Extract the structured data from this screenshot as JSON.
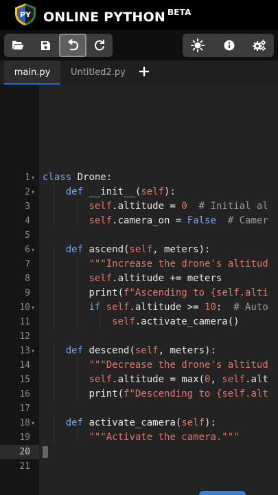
{
  "header": {
    "logo_text": "PY",
    "title": "ONLINE PYTHON",
    "badge": "BETA"
  },
  "toolbar": {
    "left_icons": [
      "folder-open-icon",
      "save-icon",
      "undo-icon",
      "redo-icon"
    ],
    "right_icons": [
      "theme-icon",
      "info-icon",
      "settings-icon"
    ]
  },
  "tabs": [
    {
      "label": "main.py",
      "active": true
    },
    {
      "label": "Untitled2.py",
      "active": false
    }
  ],
  "add_tab_icon": "plus-icon",
  "editor": {
    "current_line": 20,
    "lines": [
      {
        "n": "1",
        "fold": true,
        "indent": 0,
        "text": "class Drone:"
      },
      {
        "n": "2",
        "fold": true,
        "indent": 1,
        "text": "def __init__(self):"
      },
      {
        "n": "3",
        "fold": false,
        "indent": 2,
        "text": "self.altitude = 0  # Initial al"
      },
      {
        "n": "4",
        "fold": false,
        "indent": 2,
        "text": "self.camera_on = False  # Camer"
      },
      {
        "n": "5",
        "fold": false,
        "indent": 0,
        "text": ""
      },
      {
        "n": "6",
        "fold": true,
        "indent": 1,
        "text": "def ascend(self, meters):"
      },
      {
        "n": "7",
        "fold": false,
        "indent": 2,
        "text": "\"\"\"Increase the drone's altitud"
      },
      {
        "n": "8",
        "fold": false,
        "indent": 2,
        "text": "self.altitude += meters"
      },
      {
        "n": "9",
        "fold": false,
        "indent": 2,
        "text": "print(f\"Ascending to {self.alti"
      },
      {
        "n": "10",
        "fold": true,
        "indent": 2,
        "text": "if self.altitude >= 10:  # Auto"
      },
      {
        "n": "11",
        "fold": false,
        "indent": 3,
        "text": "self.activate_camera()"
      },
      {
        "n": "12",
        "fold": false,
        "indent": 0,
        "text": ""
      },
      {
        "n": "13",
        "fold": true,
        "indent": 1,
        "text": "def descend(self, meters):"
      },
      {
        "n": "14",
        "fold": false,
        "indent": 2,
        "text": "\"\"\"Decrease the drone's altitud"
      },
      {
        "n": "15",
        "fold": false,
        "indent": 2,
        "text": "self.altitude = max(0, self.alt"
      },
      {
        "n": "16",
        "fold": false,
        "indent": 2,
        "text": "print(f\"Descending to {self.alt"
      },
      {
        "n": "17",
        "fold": false,
        "indent": 0,
        "text": ""
      },
      {
        "n": "18",
        "fold": true,
        "indent": 1,
        "text": "def activate_camera(self):"
      },
      {
        "n": "19",
        "fold": false,
        "indent": 2,
        "text": "\"\"\"Activate the camera.\"\"\""
      },
      {
        "n": "20",
        "fold": false,
        "indent": 0,
        "text": ""
      },
      {
        "n": "21",
        "fold": false,
        "indent": 0,
        "text": ""
      }
    ]
  },
  "colors": {
    "keyword": "#7aa6f0",
    "self": "#e0766a",
    "string": "#e0766a",
    "comment": "#9a9a9a",
    "accent": "#1c6dcf"
  }
}
